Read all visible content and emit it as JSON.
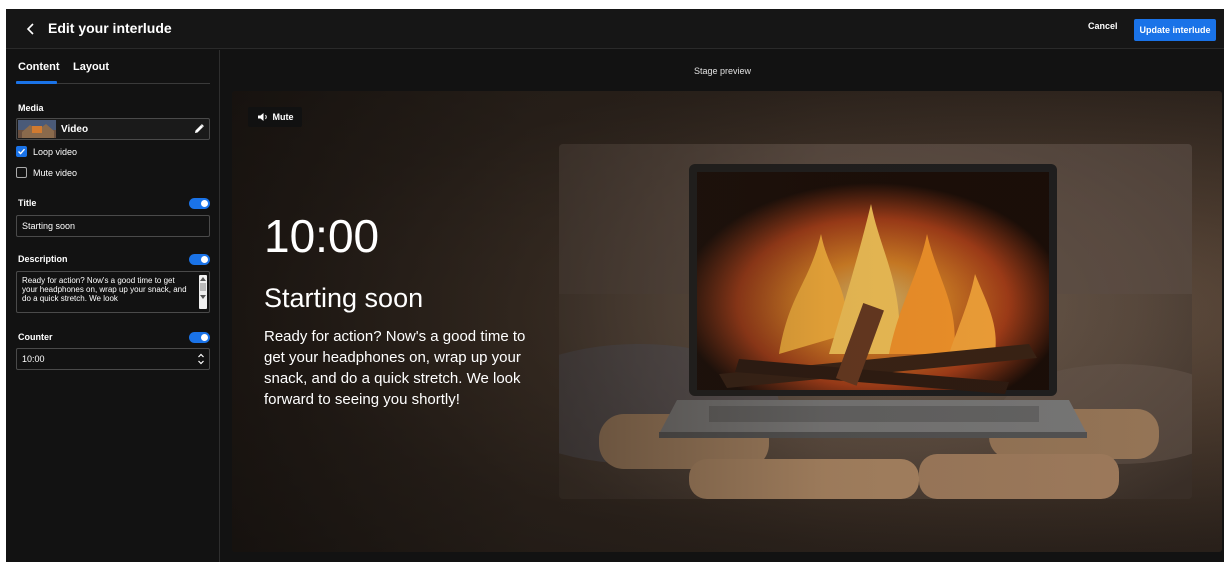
{
  "header": {
    "title": "Edit your interlude",
    "cancel_label": "Cancel",
    "update_label": "Update interlude"
  },
  "tabs": [
    {
      "label": "Content",
      "active": true
    },
    {
      "label": "Layout",
      "active": false
    }
  ],
  "form": {
    "media_label": "Media",
    "media_type": "Video",
    "loop_video_label": "Loop video",
    "loop_video_checked": true,
    "mute_video_label": "Mute video",
    "mute_video_checked": false,
    "title_label": "Title",
    "title_enabled": true,
    "title_value": "Starting soon",
    "description_label": "Description",
    "description_enabled": true,
    "description_value": "Ready for action? Now's a good time to get your headphones on, wrap up your snack, and do a quick stretch. We look",
    "counter_label": "Counter",
    "counter_enabled": true,
    "counter_value": "10:00"
  },
  "stage": {
    "label": "Stage preview",
    "mute_label": "Mute",
    "counter": "10:00",
    "title": "Starting soon",
    "description": "Ready for action? Now's a good time to get your headphones on, wrap up your snack, and do a quick stretch. We look forward to seeing you shortly!"
  },
  "colors": {
    "accent": "#1a73e8",
    "background": "#121212"
  }
}
